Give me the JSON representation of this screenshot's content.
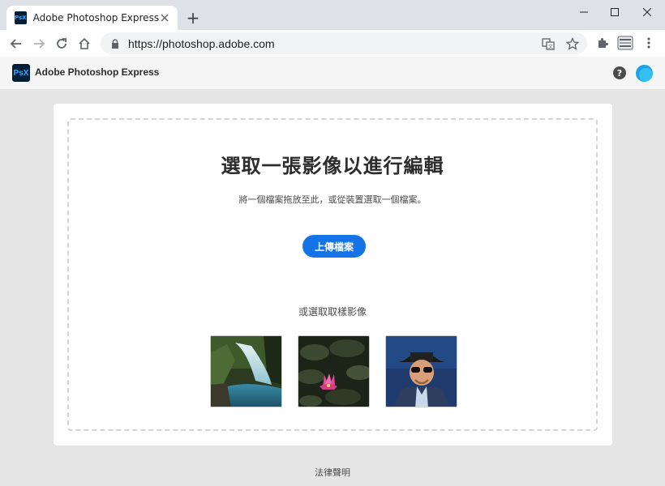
{
  "browser": {
    "tab_title": "Adobe Photoshop Express",
    "tab_favicon_text": "PsX",
    "url": "https://photoshop.adobe.com",
    "new_tab_symbol": "+"
  },
  "app": {
    "logo_text": "PsX",
    "name": "Adobe Photoshop Express",
    "help_symbol": "?"
  },
  "dropzone": {
    "title": "選取一張影像以進行編輯",
    "subtitle": "將一個檔案拖放至此，或從裝置選取一個檔案。",
    "upload_label": "上傳檔案",
    "sample_label": "或選取取樣影像"
  },
  "samples": [
    {
      "name": "waterfall"
    },
    {
      "name": "lotus-flower"
    },
    {
      "name": "man-with-hat"
    }
  ],
  "footer": {
    "legal_label": "法律聲明"
  },
  "colors": {
    "accent": "#1473e6",
    "ps_dark": "#001e36",
    "ps_blue": "#31a8ff"
  }
}
